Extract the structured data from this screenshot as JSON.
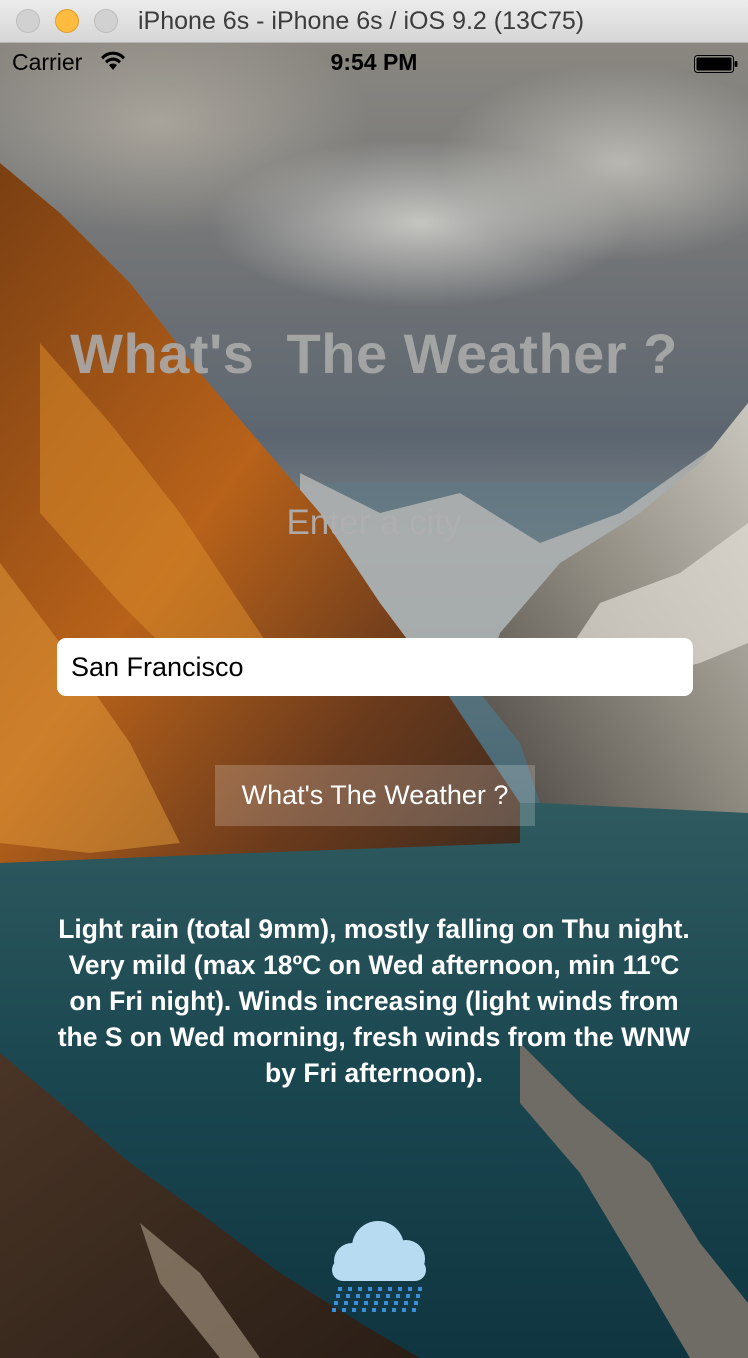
{
  "window": {
    "title": "iPhone 6s - iPhone 6s / iOS 9.2 (13C75)"
  },
  "status_bar": {
    "carrier": "Carrier",
    "time": "9:54 PM",
    "icons": [
      "wifi-icon",
      "battery-icon"
    ]
  },
  "app": {
    "headline": "What's  The Weather ?",
    "prompt": "Enter a city",
    "city_input": {
      "value": "San Francisco"
    },
    "submit_label": "What's The Weather ?",
    "forecast": "Light rain (total 9mm), mostly falling on Thu night. Very mild (max 18ºC on Wed afternoon, min 11ºC on Fri night). Winds increasing (light winds from the S on Wed morning, fresh winds from the WNW by Fri afternoon).",
    "weather_icon": "rain-cloud-icon"
  },
  "colors": {
    "headline": "#aaaaaa",
    "button_bg": "rgba(255,255,255,0.2)",
    "cloud": "#b7dcf2",
    "rain": "#3b8ed8"
  }
}
